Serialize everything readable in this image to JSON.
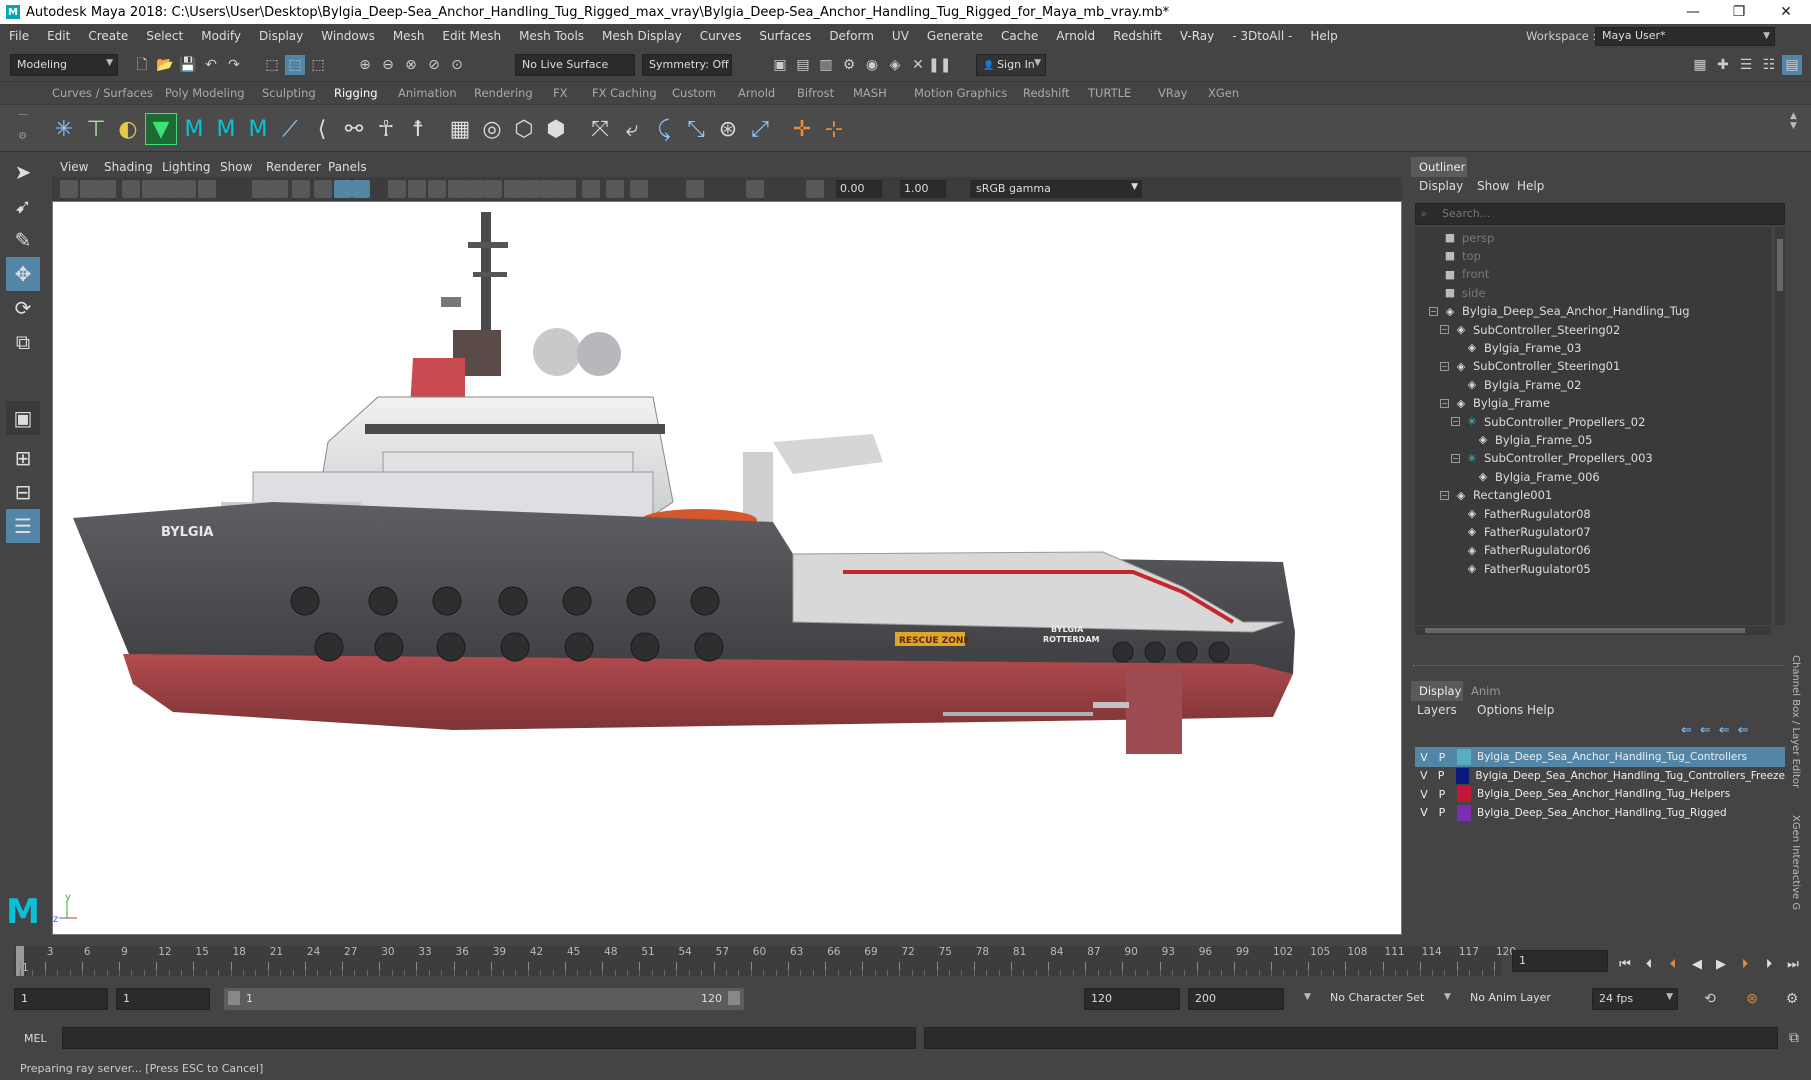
{
  "window": {
    "title": "Autodesk Maya 2018: C:\\Users\\User\\Desktop\\Bylgia_Deep-Sea_Anchor_Handling_Tug_Rigged_max_vray\\Bylgia_Deep-Sea_Anchor_Handling_Tug_Rigged_for_Maya_mb_vray.mb*"
  },
  "menu": [
    "File",
    "Edit",
    "Create",
    "Select",
    "Modify",
    "Display",
    "Windows",
    "Mesh",
    "Edit Mesh",
    "Mesh Tools",
    "Mesh Display",
    "Curves",
    "Surfaces",
    "Deform",
    "UV",
    "Generate",
    "Cache",
    "Arnold",
    "Redshift",
    "V-Ray",
    "- 3DtoAll -",
    "Help"
  ],
  "workspace": {
    "label": "Workspace :",
    "value": "Maya User*"
  },
  "status": {
    "mode": "Modeling",
    "live_surface": "No Live Surface",
    "symmetry": "Symmetry: Off",
    "sign_in": "Sign In"
  },
  "shelf_tabs": [
    "Curves / Surfaces",
    "Poly Modeling",
    "Sculpting",
    "Rigging",
    "Animation",
    "Rendering",
    "FX",
    "FX Caching",
    "Custom",
    "Arnold",
    "Bifrost",
    "MASH",
    "Motion Graphics",
    "Redshift",
    "TURTLE",
    "VRay",
    "XGen"
  ],
  "active_shelf": "Rigging",
  "panel_menu": [
    "View",
    "Shading",
    "Lighting",
    "Show",
    "Renderer",
    "Panels"
  ],
  "panel_values": {
    "exposure": "0.00",
    "gamma": "1.00",
    "colorspace": "sRGB gamma"
  },
  "viewport": {
    "ship_name": "BYLGIA",
    "rescue": "RESCUE ZONE",
    "stern_name": "BYLGIA",
    "stern_port": "ROTTERDAM",
    "axis_y": "y",
    "axis_z": "z"
  },
  "outliner": {
    "tab": "Outliner",
    "menu": [
      "Display",
      "Show",
      "Help"
    ],
    "search_placeholder": "Search...",
    "items": [
      {
        "label": "persp",
        "indent": 0,
        "icon": "camera-icon",
        "dim": true
      },
      {
        "label": "top",
        "indent": 0,
        "icon": "camera-icon",
        "dim": true
      },
      {
        "label": "front",
        "indent": 0,
        "icon": "camera-icon",
        "dim": true
      },
      {
        "label": "side",
        "indent": 0,
        "icon": "camera-icon",
        "dim": true
      },
      {
        "label": "Bylgia_Deep_Sea_Anchor_Handling_Tug",
        "indent": 0,
        "icon": "group-icon",
        "expand": "−"
      },
      {
        "label": "SubController_Steering02",
        "indent": 1,
        "icon": "group-icon",
        "expand": "−"
      },
      {
        "label": "Bylgia_Frame_03",
        "indent": 2,
        "icon": "mesh-icon"
      },
      {
        "label": "SubController_Steering01",
        "indent": 1,
        "icon": "group-icon",
        "expand": "−"
      },
      {
        "label": "Bylgia_Frame_02",
        "indent": 2,
        "icon": "mesh-icon"
      },
      {
        "label": "Bylgia_Frame",
        "indent": 1,
        "icon": "group-icon",
        "expand": "−"
      },
      {
        "label": "SubController_Propellers_02",
        "indent": 2,
        "icon": "joint-icon",
        "expand": "−"
      },
      {
        "label": "Bylgia_Frame_05",
        "indent": 3,
        "icon": "mesh-icon"
      },
      {
        "label": "SubController_Propellers_003",
        "indent": 2,
        "icon": "joint-icon",
        "expand": "−"
      },
      {
        "label": "Bylgia_Frame_006",
        "indent": 3,
        "icon": "mesh-icon"
      },
      {
        "label": "Rectangle001",
        "indent": 1,
        "icon": "group-icon",
        "expand": "−"
      },
      {
        "label": "FatherRugulator08",
        "indent": 2,
        "icon": "mesh-icon"
      },
      {
        "label": "FatherRugulator07",
        "indent": 2,
        "icon": "mesh-icon"
      },
      {
        "label": "FatherRugulator06",
        "indent": 2,
        "icon": "mesh-icon"
      },
      {
        "label": "FatherRugulator05",
        "indent": 2,
        "icon": "mesh-icon"
      }
    ]
  },
  "layer_editor": {
    "tabs": [
      "Display",
      "Anim"
    ],
    "menu": [
      "Layers",
      "Options",
      "Help"
    ],
    "side_label": "Channel Box / Layer Editor",
    "side_label2": "XGen Interactive G",
    "layers": [
      {
        "v": "V",
        "p": "P",
        "name": "Bylgia_Deep_Sea_Anchor_Handling_Tug_Controllers",
        "color": "#5aaec0",
        "selected": true
      },
      {
        "v": "V",
        "p": "P",
        "name": "Bylgia_Deep_Sea_Anchor_Handling_Tug_Controllers_Freeze",
        "color": "#0b1a7a",
        "selected": false
      },
      {
        "v": "V",
        "p": "P",
        "name": "Bylgia_Deep_Sea_Anchor_Handling_Tug_Helpers",
        "color": "#c2173a",
        "selected": false
      },
      {
        "v": "V",
        "p": "P",
        "name": "Bylgia_Deep_Sea_Anchor_Handling_Tug_Rigged",
        "color": "#7b2fb0",
        "selected": false
      }
    ]
  },
  "timeline": {
    "ticks": [
      "1",
      "3",
      "6",
      "9",
      "12",
      "15",
      "18",
      "21",
      "24",
      "27",
      "30",
      "33",
      "36",
      "39",
      "42",
      "45",
      "48",
      "51",
      "54",
      "57",
      "60",
      "63",
      "66",
      "69",
      "72",
      "75",
      "78",
      "81",
      "84",
      "87",
      "90",
      "93",
      "96",
      "99",
      "102",
      "105",
      "108",
      "111",
      "114",
      "117",
      "120"
    ],
    "current": "1"
  },
  "range": {
    "start": "1",
    "playback_start": "1",
    "slider_start": "1",
    "slider_end": "120",
    "playback_end": "120",
    "end": "200",
    "character_set": "No Character Set",
    "anim_layer": "No Anim Layer",
    "fps": "24 fps"
  },
  "mel": {
    "label": "MEL"
  },
  "help": {
    "text": "Preparing ray server... [Press ESC to Cancel]"
  }
}
